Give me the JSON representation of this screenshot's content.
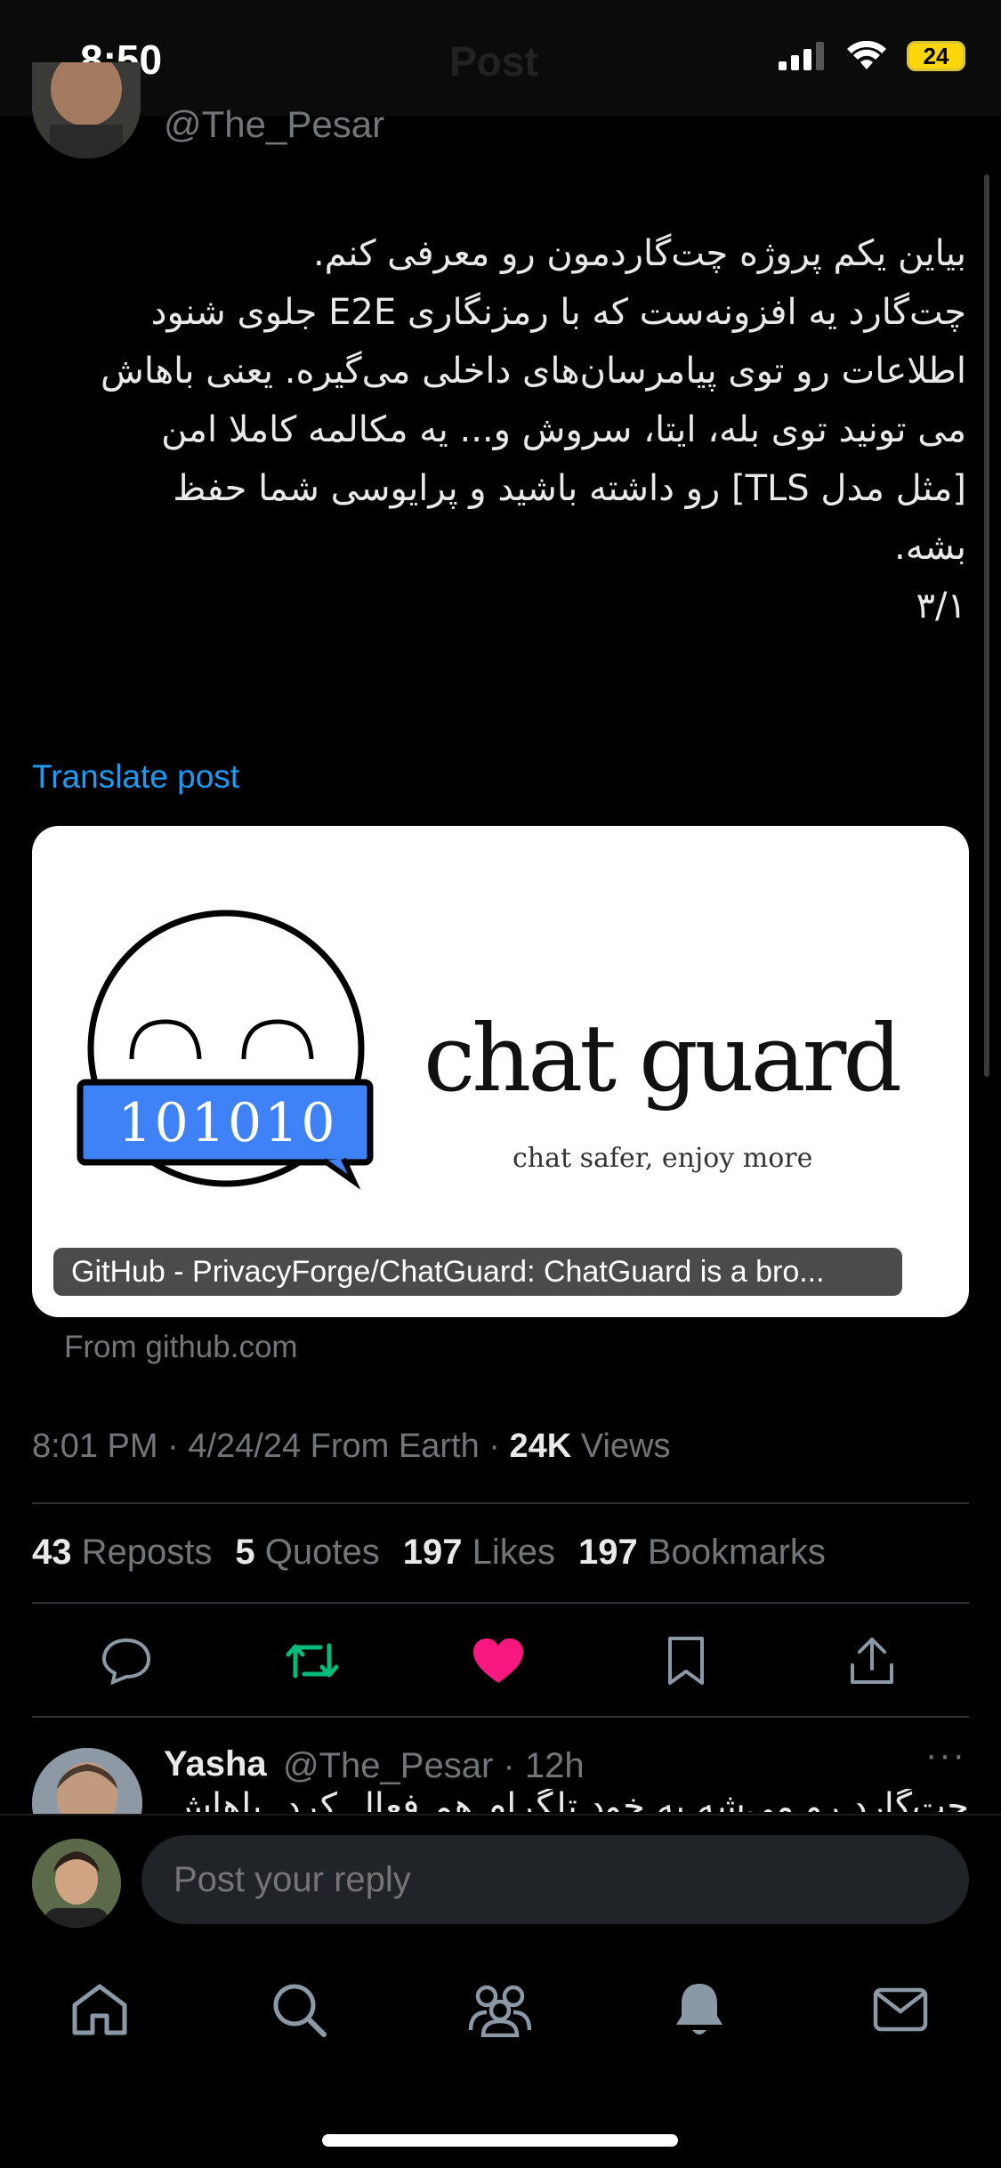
{
  "status_bar": {
    "time": "8:50",
    "battery": "24"
  },
  "header": {
    "ghost_title": "Post"
  },
  "author": {
    "handle": "@The_Pesar"
  },
  "tweet": {
    "text": "بیاین یکم پروژه چت‌گاردمون رو معرفی کنم.\nچت‌گارد یه افزونه‌ست که با رمزنگاری E2E جلوی شنود\nاطلاعات رو توی پیامرسان‌های داخلی می‌گیره. یعنی باهاش\nمی تونید توی بله، ایتا، سروش و... یه مکالمه کاملا امن\n[مثل مدل TLS] رو داشته باشید و پرایوسی شما حفظ\nبشه.\n۳/۱",
    "translate_label": "Translate post"
  },
  "card": {
    "logo_code": "101010",
    "brand": "chat guard",
    "tagline": "chat safer, enjoy more",
    "caption": "GitHub - PrivacyForge/ChatGuard: ChatGuard is a bro...",
    "source": "From github.com"
  },
  "meta": {
    "time": "8:01 PM",
    "date": "4/24/24",
    "location": "From Earth",
    "views_count": "24K",
    "views_label": "Views"
  },
  "stats": [
    {
      "count": "43",
      "label": "Reposts"
    },
    {
      "count": "5",
      "label": "Quotes"
    },
    {
      "count": "197",
      "label": "Likes"
    },
    {
      "count": "197",
      "label": "Bookmarks"
    }
  ],
  "colors": {
    "accent": "#1d9bf0",
    "repost": "#00ba7c",
    "like": "#f91880",
    "logo_blue": "#3f82f7"
  },
  "reply": {
    "name": "Yasha",
    "handle": "@The_Pesar",
    "time": "· 12h",
    "more": "···",
    "text": "چت‌گارد رو می‌شه به خود تلگرام هم فعال کرد. باهاش"
  },
  "composer": {
    "placeholder": "Post your reply"
  },
  "tabs": [
    "home-icon",
    "search-icon",
    "communities-icon",
    "notifications-icon",
    "messages-icon"
  ]
}
